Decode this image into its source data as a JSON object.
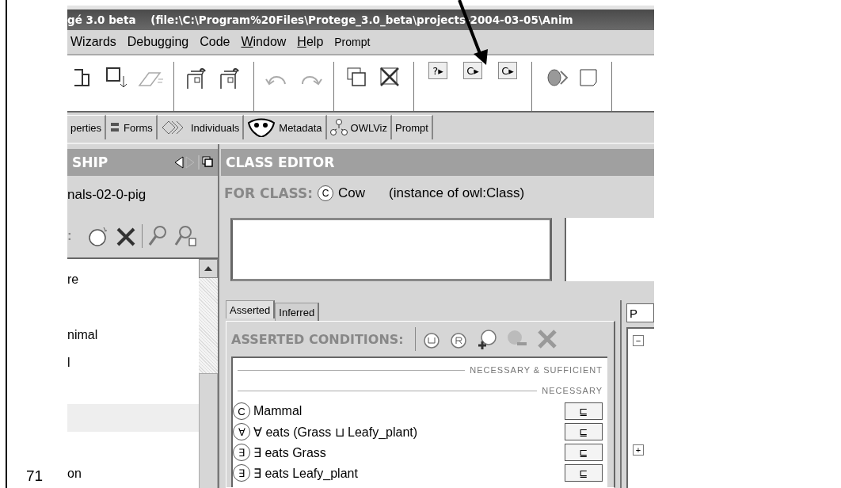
{
  "slide": {
    "page_number": "71"
  },
  "window": {
    "title": "gé 3.0 beta    (file:\\C:\\Program%20Files\\Protege_3.0_beta\\projects-2004-03-05\\Anim"
  },
  "menu": [
    {
      "label": "Wizards",
      "mnemonic": false
    },
    {
      "label": "Debugging",
      "mnemonic": false
    },
    {
      "label": "Code",
      "mnemonic": false
    },
    {
      "label": "Window",
      "mnemonic": true
    },
    {
      "label": "Help",
      "mnemonic": true
    },
    {
      "label": "Prompt",
      "mnemonic": false,
      "small": true
    }
  ],
  "toolbar": [
    {
      "kind": "tool"
    },
    {
      "kind": "tool"
    },
    {
      "kind": "tool",
      "disabled": true
    },
    {
      "kind": "sep"
    },
    {
      "kind": "tool"
    },
    {
      "kind": "tool"
    },
    {
      "kind": "sep"
    },
    {
      "kind": "tool",
      "disabled": true
    },
    {
      "kind": "tool",
      "disabled": true
    },
    {
      "kind": "sep"
    },
    {
      "kind": "tool"
    },
    {
      "kind": "tool"
    },
    {
      "kind": "sep"
    },
    {
      "kind": "key",
      "glyph": "?▸"
    },
    {
      "kind": "key",
      "glyph": "C▸"
    },
    {
      "kind": "key",
      "glyph": "C▸"
    },
    {
      "kind": "sep"
    },
    {
      "kind": "tool"
    },
    {
      "kind": "tool"
    },
    {
      "kind": "sep"
    }
  ],
  "tabs": [
    {
      "label": "perties"
    },
    {
      "label": "Forms"
    },
    {
      "label": "Individuals"
    },
    {
      "label": "Metadata"
    },
    {
      "label": "OWLViz"
    },
    {
      "label": "Prompt"
    }
  ],
  "left_panel": {
    "title": "SHIP",
    "project": "nals-02-0-pig",
    "toolbar_label": ":",
    "items": [
      {
        "label": "re",
        "selected": false
      },
      {
        "label": "nimal",
        "selected": false
      },
      {
        "label": "l",
        "selected": false
      },
      {
        "selected": true
      },
      {
        "label": "on",
        "selected": false
      }
    ]
  },
  "class_editor": {
    "title": "CLASS EDITOR",
    "for_class_label": "FOR CLASS:",
    "class_badge": "C",
    "class_name": "Cow",
    "class_type": "(instance of owl:Class)",
    "condition_tabs": [
      {
        "label": "Asserted",
        "selected": true
      },
      {
        "label": "Inferred",
        "selected": false
      }
    ],
    "conditions_title": "ASSERTED CONDITIONS:",
    "sections": [
      {
        "title": "NECESSARY & SUFFICIENT"
      },
      {
        "title": "NECESSARY",
        "rows": [
          {
            "badge": "C",
            "text": "Mammal",
            "relation": "⊑"
          },
          {
            "badge": "∀",
            "text": "∀ eats (Grass ⊔ Leafy_plant)",
            "relation": "⊑"
          },
          {
            "badge": "∃",
            "text": "∃ eats Grass",
            "relation": "⊑"
          },
          {
            "badge": "∃",
            "text": "∃ eats Leafy_plant",
            "relation": "⊑"
          }
        ]
      }
    ]
  },
  "side_panel": {
    "tab": "P",
    "toggles": [
      "−",
      "+"
    ]
  }
}
